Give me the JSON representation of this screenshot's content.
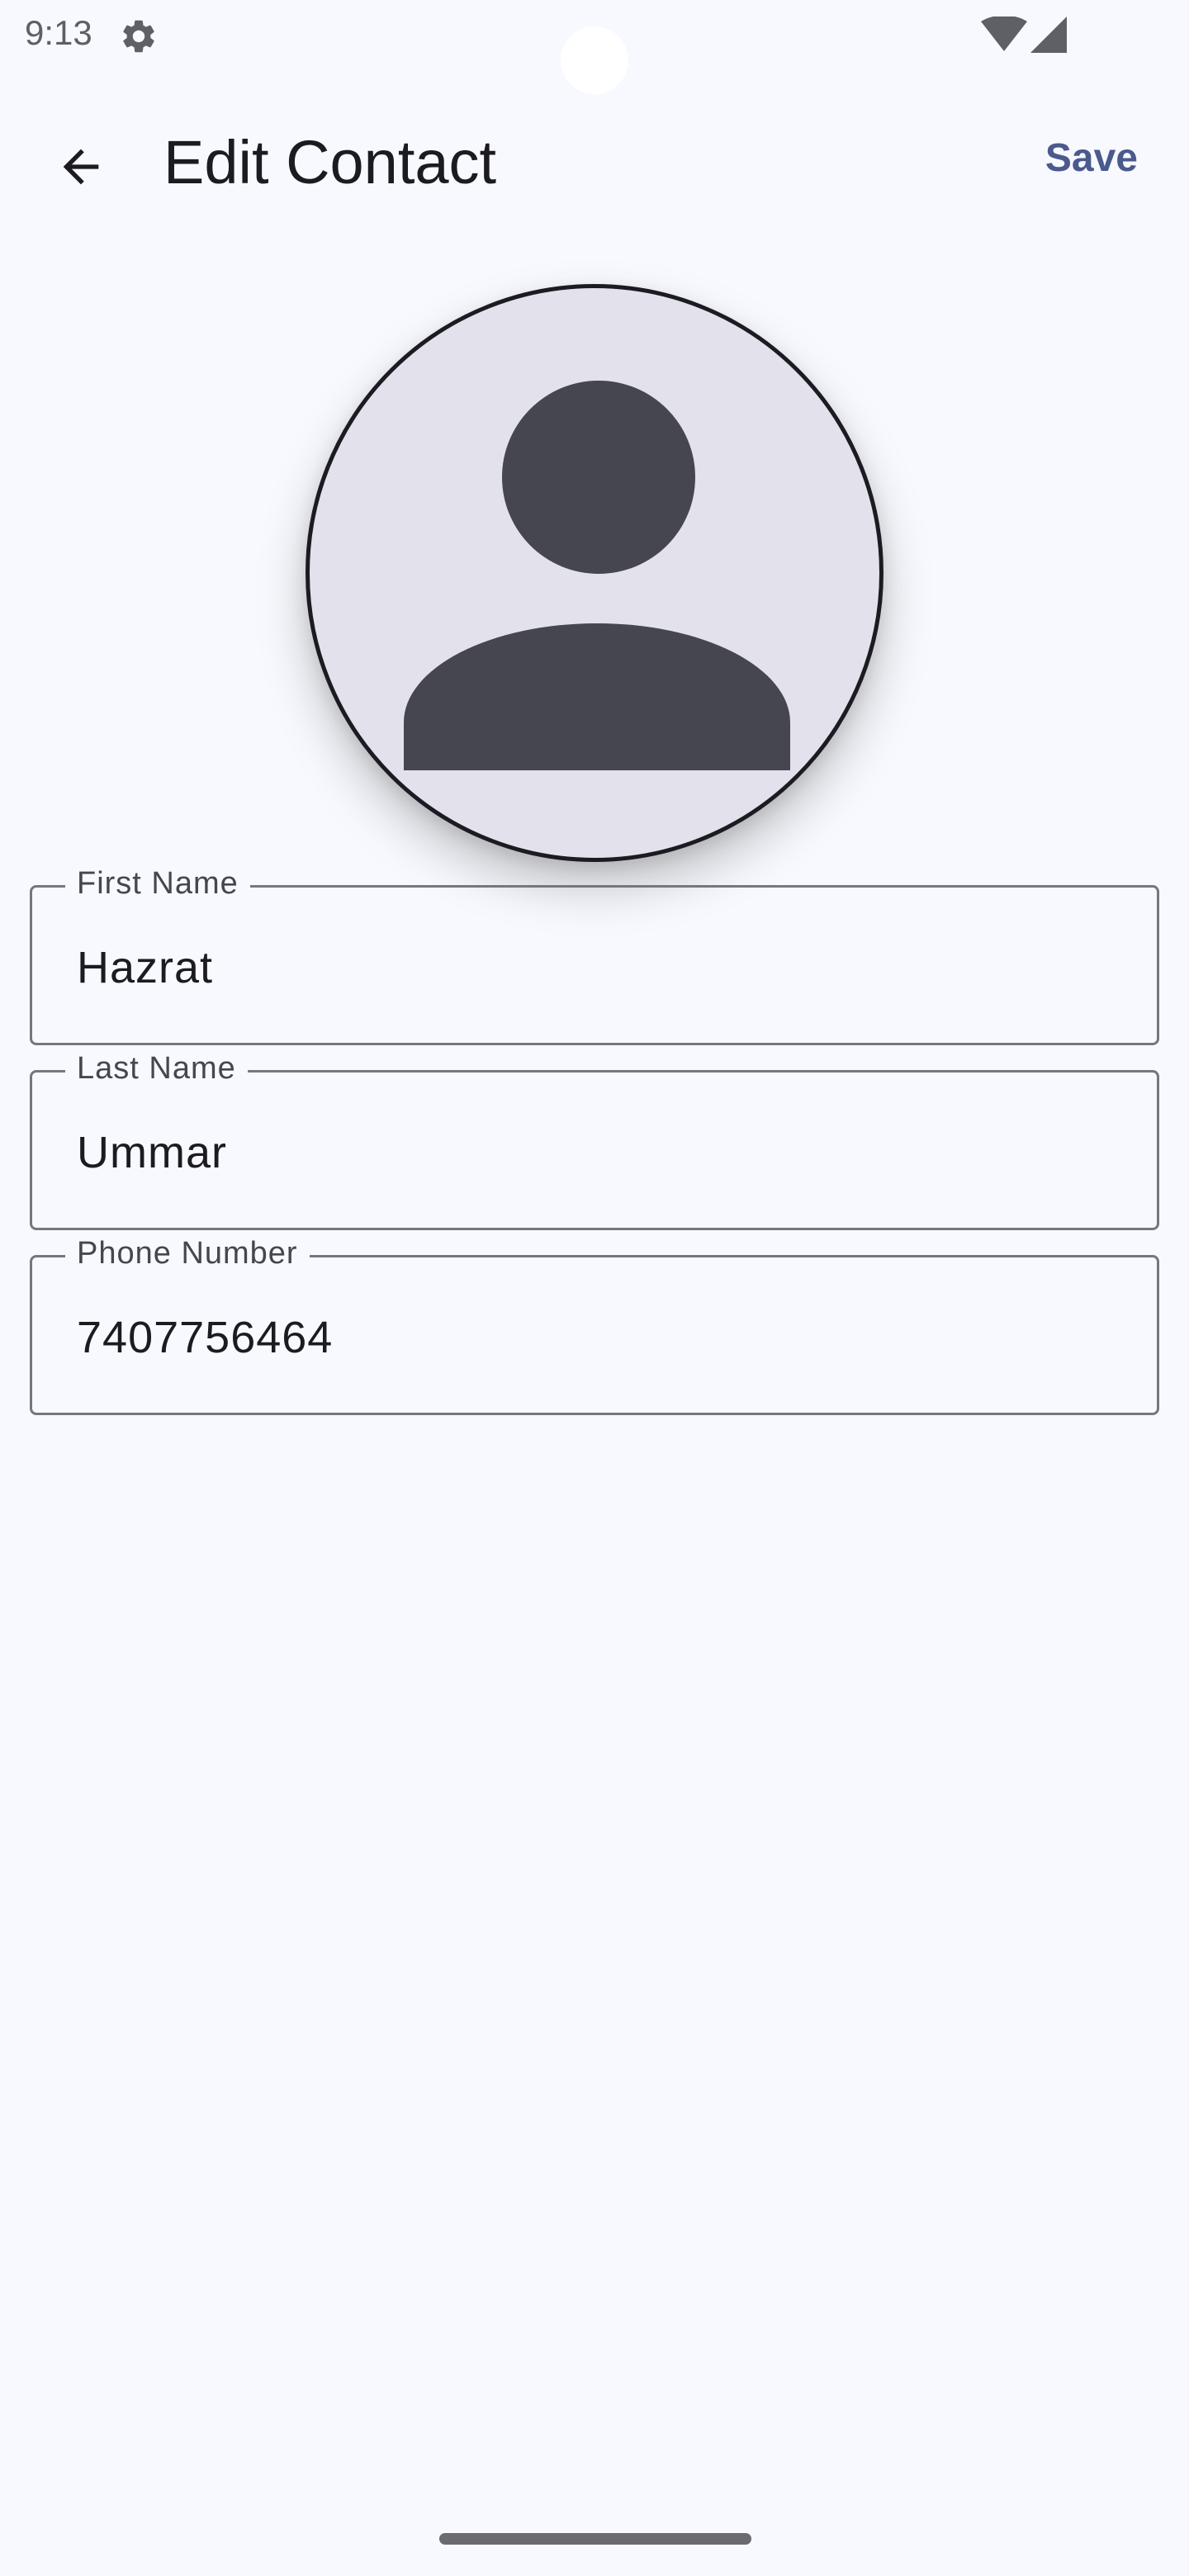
{
  "status_bar": {
    "time": "9:13",
    "icons": [
      "settings-gear-icon",
      "wifi-icon",
      "signal-icon"
    ]
  },
  "app_bar": {
    "back_icon": "arrow-back-icon",
    "title": "Edit Contact",
    "save_label": "Save"
  },
  "avatar": {
    "icon": "person-placeholder-icon"
  },
  "form": {
    "first_name": {
      "label": "First Name",
      "value": "Hazrat"
    },
    "last_name": {
      "label": "Last Name",
      "value": "Ummar"
    },
    "phone_number": {
      "label": "Phone Number",
      "value": "7407756464"
    }
  },
  "colors": {
    "background": "#f7f9fe",
    "accent": "#4a5a8c",
    "avatar_fill": "#e2e1ec",
    "avatar_icon": "#45464f",
    "outline": "#767680"
  }
}
